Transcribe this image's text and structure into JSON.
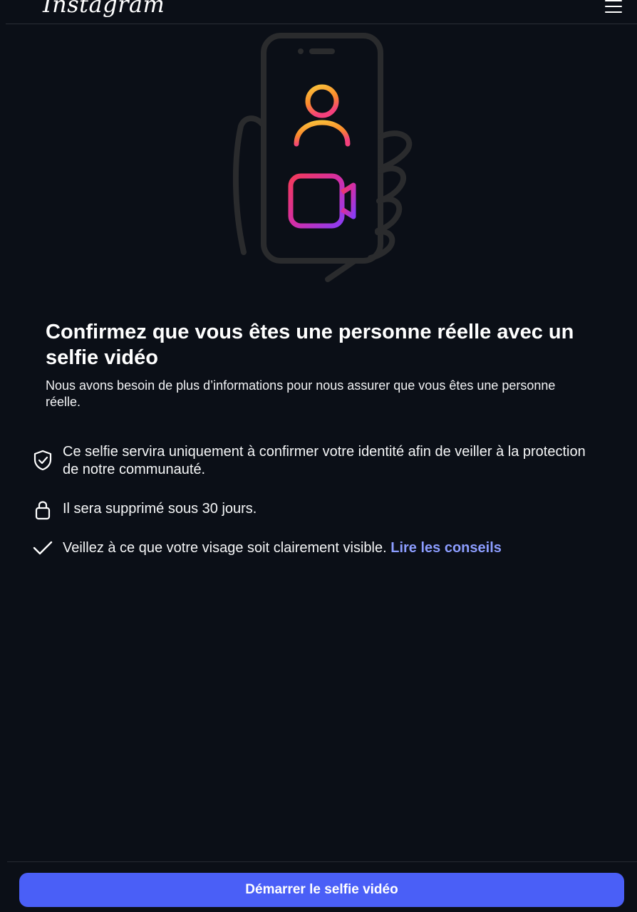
{
  "header": {
    "logo_text": "Instagram",
    "menu_icon": "hamburger-menu-icon"
  },
  "illustration": {
    "icons": [
      "hand-holding-phone-icon",
      "person-icon",
      "video-camera-icon"
    ]
  },
  "main": {
    "title": "Confirmez que vous êtes une personne réelle avec un selfie vidéo",
    "subtitle": "Nous avons besoin de plus d’informations pour nous assurer que vous êtes une personne réelle.",
    "features": [
      {
        "icon": "shield-check-icon",
        "text": "Ce selfie servira uniquement à confirmer votre identité afin de veiller à la protection de notre communauté."
      },
      {
        "icon": "lock-icon",
        "text": "Il sera supprimé sous 30 jours."
      },
      {
        "icon": "check-icon",
        "text": "Veillez à ce que votre visage soit clairement visible.",
        "link": "Lire les conseils"
      }
    ]
  },
  "footer": {
    "cta_label": "Démarrer le selfie vidéo"
  },
  "colors": {
    "background": "#0b0f17",
    "accent": "#4a5ff7",
    "link": "#8c9dff"
  }
}
